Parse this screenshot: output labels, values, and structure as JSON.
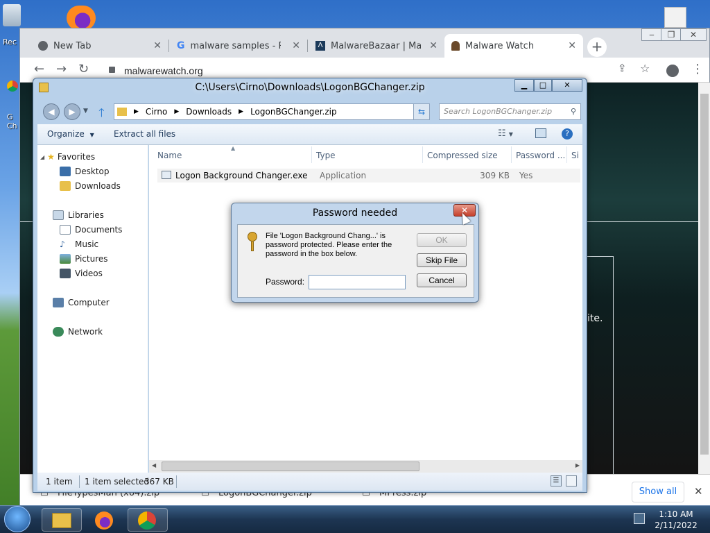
{
  "desktop": {
    "recycle_label": "Rec",
    "icon2_label": "G\nCh"
  },
  "chrome": {
    "tabs": [
      {
        "label": "New Tab",
        "close": "✕"
      },
      {
        "label": "malware samples - Reche",
        "close": "✕"
      },
      {
        "label": "MalwareBazaar | Malware",
        "close": "✕"
      },
      {
        "label": "Malware Watch",
        "close": "✕"
      }
    ],
    "new_tab": "+",
    "url": "malwarewatch.org",
    "page_fragment": "ite.",
    "downloads": [
      {
        "label": "FileTypesMan (x64).zip"
      },
      {
        "label": "LogonBGChanger.zip"
      },
      {
        "label": "MPress.zip"
      }
    ],
    "show_all": "Show all",
    "close_bar": "✕"
  },
  "explorer": {
    "title": "C:\\Users\\Cirno\\Downloads\\LogonBGChanger.zip",
    "breadcrumb": [
      "Cirno",
      "Downloads",
      "LogonBGChanger.zip"
    ],
    "search_placeholder": "Search LogonBGChanger.zip",
    "commands": {
      "organize": "Organize",
      "extract": "Extract all files"
    },
    "nav": {
      "favorites": "Favorites",
      "desktop": "Desktop",
      "downloads": "Downloads",
      "libraries": "Libraries",
      "documents": "Documents",
      "music": "Music",
      "pictures": "Pictures",
      "videos": "Videos",
      "computer": "Computer",
      "network": "Network"
    },
    "columns": [
      "Name",
      "Type",
      "Compressed size",
      "Password ...",
      "Si"
    ],
    "files": [
      {
        "name": "Logon Background Changer.exe",
        "type": "Application",
        "size": "309 KB",
        "password": "Yes"
      }
    ],
    "status": {
      "count": "1 item",
      "selected": "1 item selected",
      "size": "367 KB"
    }
  },
  "dialog": {
    "title": "Password needed",
    "message": "File 'Logon Background Chang...' is password protected.  Please enter the password in the box below.",
    "password_label": "Password:",
    "password_value": "",
    "ok": "OK",
    "skip": "Skip File",
    "cancel": "Cancel"
  },
  "taskbar": {
    "time": "1:10 AM",
    "date": "2/11/2022"
  }
}
